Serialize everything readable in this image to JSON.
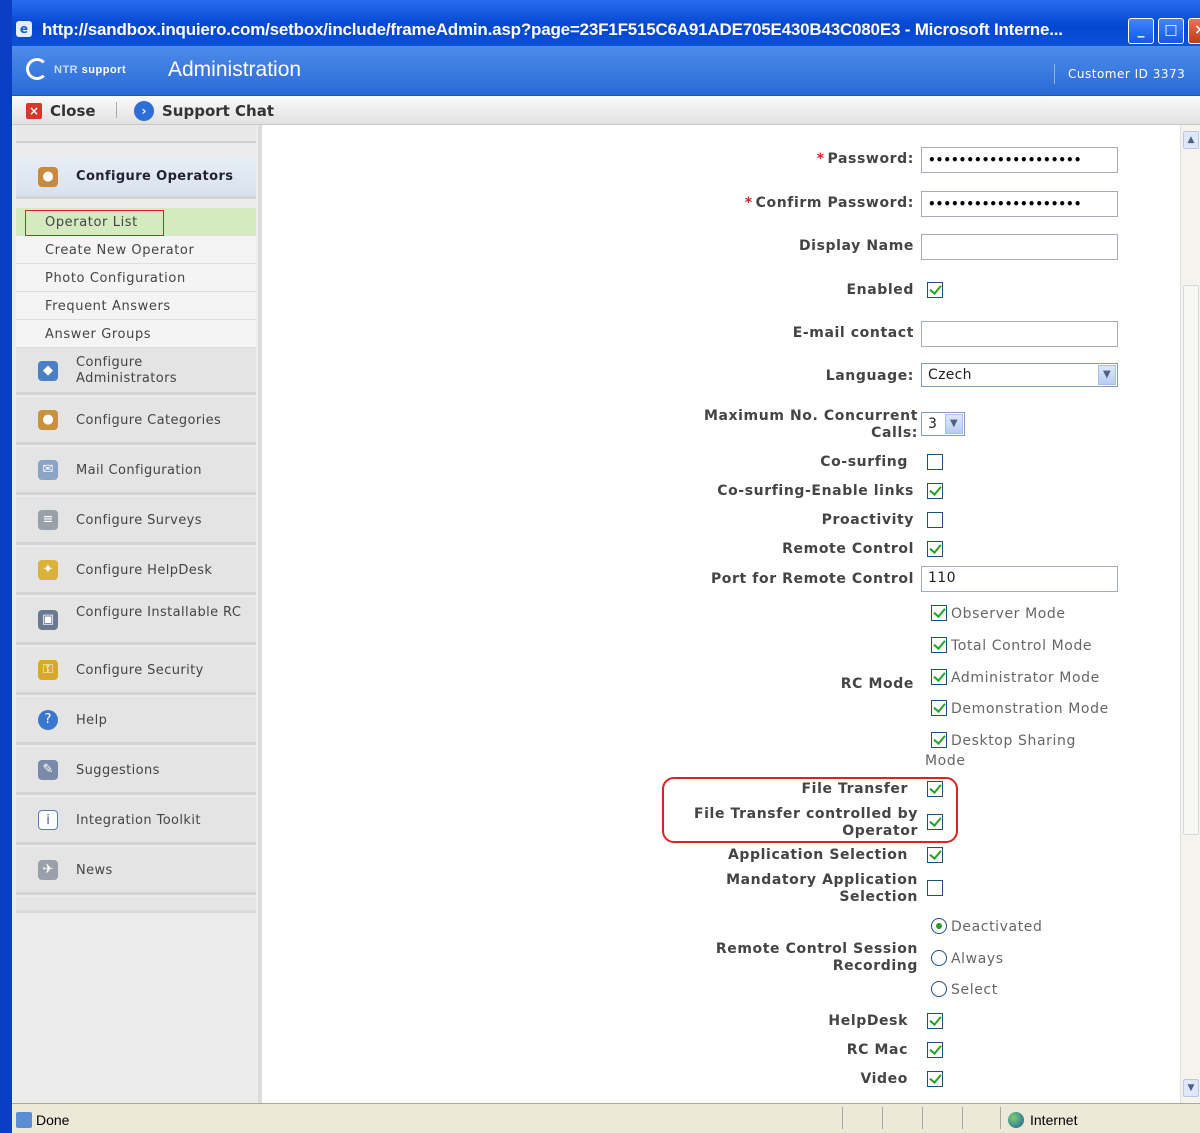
{
  "window": {
    "title": "http://sandbox.inquiero.com/setbox/include/frameAdmin.asp?page=23F1F515C6A91ADE705E430B43C080E3 - Microsoft Interne...",
    "buttons": [
      "_",
      "□",
      "×"
    ]
  },
  "header": {
    "logo_prefix": "NTR",
    "logo_suffix": "support",
    "title": "Administration",
    "customer_id": "Customer ID 3373"
  },
  "toolbar": {
    "close_label": "Close",
    "chat_label": "Support Chat"
  },
  "sidebar": {
    "sections": [
      {
        "label": "Configure Operators",
        "icon": "operator-icon",
        "active": true
      },
      {
        "label": "Configure Administrators",
        "icon": "administrators-icon"
      },
      {
        "label": "Configure Categories",
        "icon": "categories-icon"
      },
      {
        "label": "Mail Configuration",
        "icon": "mail-icon"
      },
      {
        "label": "Configure Surveys",
        "icon": "survey-icon"
      },
      {
        "label": "Configure HelpDesk",
        "icon": "helpdesk-icon"
      },
      {
        "label": "Configure Installable RC",
        "icon": "installable-rc-icon"
      },
      {
        "label": "Configure Security",
        "icon": "security-icon"
      },
      {
        "label": "Help",
        "icon": "help-icon"
      },
      {
        "label": "Suggestions",
        "icon": "suggestions-icon"
      },
      {
        "label": "Integration Toolkit",
        "icon": "integration-icon"
      },
      {
        "label": "News",
        "icon": "news-icon"
      }
    ],
    "subitems": [
      "Operator List",
      "Create New Operator",
      "Photo Configuration",
      "Frequent Answers",
      "Answer Groups"
    ]
  },
  "form": {
    "password_label": "Password:",
    "password_value": "••••••••••••••••••••",
    "confirm_label": "Confirm Password:",
    "confirm_value": "••••••••••••••••••••",
    "display_name_label": "Display Name",
    "display_name_value": "",
    "enabled_label": "Enabled",
    "email_label": "E-mail contact",
    "email_value": "",
    "language_label": "Language:",
    "language_value": "Czech",
    "max_calls_label_1": "Maximum No. Concurrent",
    "max_calls_label_2": "Calls:",
    "max_calls_value": "3",
    "cosurfing_label": "Co-surfing",
    "cosurfing_links_label": "Co-surfing-Enable links",
    "proactivity_label": "Proactivity",
    "remote_control_label": "Remote Control",
    "port_label": "Port for Remote Control",
    "port_value": "110",
    "rc_mode_label": "RC Mode",
    "rc_modes": [
      "Observer Mode",
      "Total Control Mode",
      "Administrator Mode",
      "Demonstration Mode",
      "Desktop Sharing"
    ],
    "rc_mode_wrap": "Mode",
    "file_transfer_label": "File Transfer",
    "ft_operator_label_1": "File Transfer controlled by",
    "ft_operator_label_2": "Operator",
    "app_selection_label": "Application Selection",
    "mandatory_label_1": "Mandatory Application",
    "mandatory_label_2": "Selection",
    "recording_label_1": "Remote Control Session",
    "recording_label_2": "Recording",
    "recording_options": [
      "Deactivated",
      "Always",
      "Select"
    ],
    "recording_selected": "Deactivated",
    "helpdesk_label": "HelpDesk",
    "rcmac_label": "RC Mac",
    "video_label": "Video"
  },
  "status": {
    "left": "Done",
    "zone": "Internet"
  }
}
